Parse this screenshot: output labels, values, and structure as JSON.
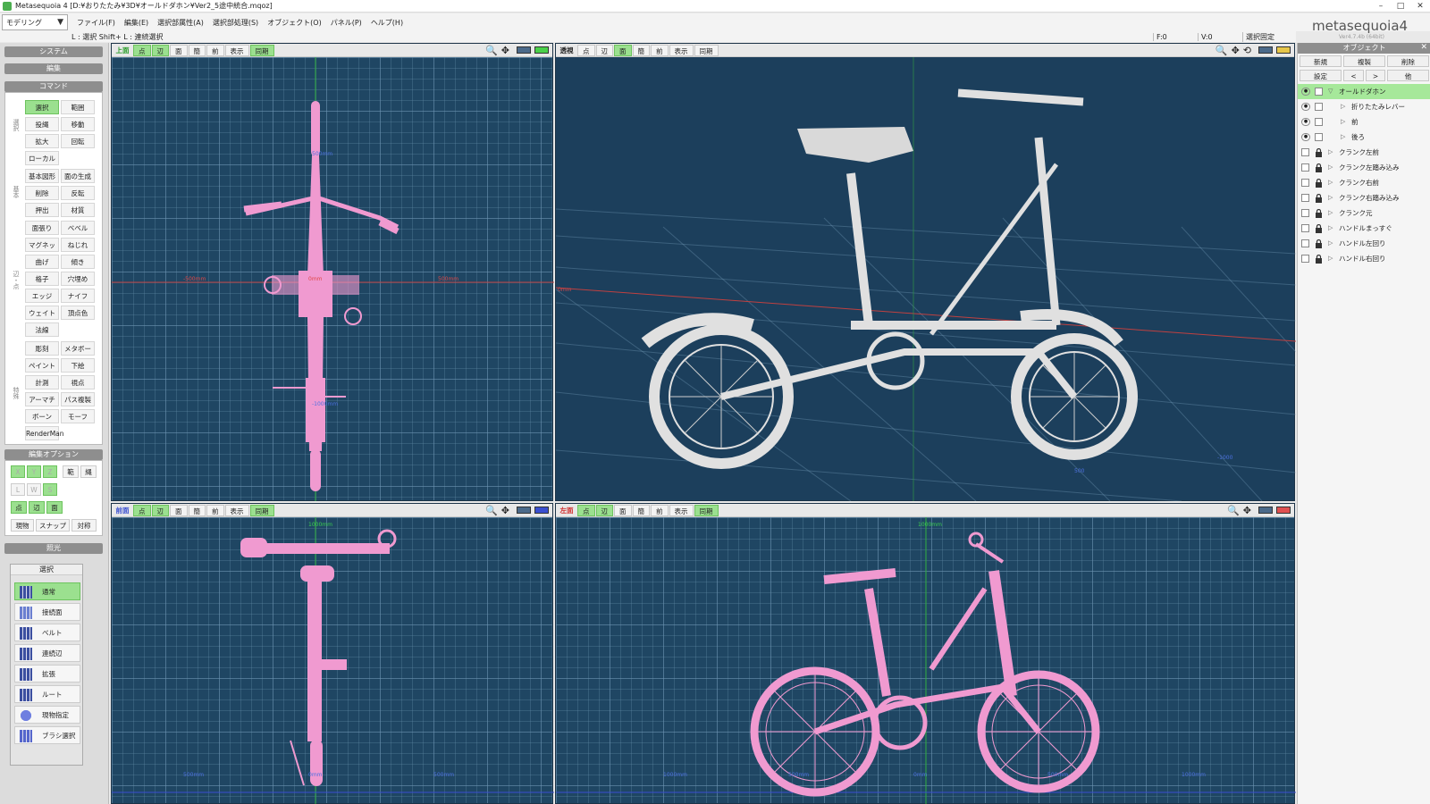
{
  "window": {
    "title": "Metasequoia 4 [D:¥おりたたみ¥3D¥オールドダホン¥Ver2_5途中統合.mqoz]",
    "minimize": "–",
    "maximize": "□",
    "close": "✕"
  },
  "mode": "モデリング",
  "menu": [
    "ファイル(F)",
    "編集(E)",
    "選択部属性(A)",
    "選択部処理(S)",
    "オブジェクト(O)",
    "パネル(P)",
    "ヘルプ(H)"
  ],
  "status": {
    "hint": "L : 選択 Shift+ L : 連続選択",
    "f": "F:0",
    "v": "V:0",
    "lock": "選択固定"
  },
  "logo": {
    "text": "metasequoia4",
    "version": "Ver4.7.4b (64bit)"
  },
  "left": {
    "system": "システム",
    "edit": "編集",
    "command": "コマンド",
    "groups": [
      "選択",
      "基本",
      "辺・点",
      "特殊"
    ],
    "commands": [
      {
        "label": "選択",
        "key": "L",
        "active": true
      },
      {
        "label": "範囲",
        "key": "R"
      },
      {
        "label": "投縄",
        "key": "G"
      },
      {
        "label": "移動",
        "key": "V"
      },
      {
        "label": "拡大",
        "key": "Q"
      },
      {
        "label": "回転",
        "key": "C"
      },
      {
        "label": "ローカル",
        "key": "J"
      },
      {
        "label": "基本図形",
        "key": "Z"
      },
      {
        "label": "面の生成",
        "key": "F"
      },
      {
        "label": "削除",
        "key": "D"
      },
      {
        "label": "反転",
        "key": "I"
      },
      {
        "label": "押出",
        "key": "E"
      },
      {
        "label": "材質",
        "key": "M"
      },
      {
        "label": "面張り",
        "key": "H"
      },
      {
        "label": "ベベル",
        "key": ""
      },
      {
        "label": "マグネット",
        "key": "B"
      },
      {
        "label": "ねじれ",
        "key": ""
      },
      {
        "label": "曲げ",
        "key": ""
      },
      {
        "label": "傾き",
        "key": ""
      },
      {
        "label": "格子",
        "key": ""
      },
      {
        "label": "穴埋め",
        "key": ""
      },
      {
        "label": "エッジ",
        "key": "W"
      },
      {
        "label": "ナイフ",
        "key": "K"
      },
      {
        "label": "ウェイト",
        "key": ""
      },
      {
        "label": "頂点色",
        "key": ""
      },
      {
        "label": "法線",
        "key": ""
      },
      {
        "label": "彫刻",
        "key": ""
      },
      {
        "label": "メタボール",
        "key": ""
      },
      {
        "label": "ペイント",
        "key": ""
      },
      {
        "label": "下絵",
        "key": ""
      },
      {
        "label": "計測",
        "key": ""
      },
      {
        "label": "視点",
        "key": ""
      },
      {
        "label": "アーマチャー",
        "key": ""
      },
      {
        "label": "パス複製",
        "key": ""
      },
      {
        "label": "ボーン",
        "key": ""
      },
      {
        "label": "モーフ",
        "key": ""
      },
      {
        "label": "RenderMan",
        "key": ""
      }
    ],
    "edit_option": "編集オプション",
    "axis": [
      "X",
      "Y",
      "Z"
    ],
    "range": "範",
    "cont": "縄",
    "lwsbtns": [
      "L",
      "W",
      "S"
    ],
    "pem": [
      "点",
      "辺",
      "面"
    ],
    "misc": [
      "現物",
      "スナップ",
      "対称"
    ],
    "lighting": "照光",
    "select_panel": {
      "title": "選択",
      "items": [
        "通常",
        "接続面",
        "ベルト",
        "連続辺",
        "拡張",
        "ルート",
        "現物指定",
        "ブラシ選択"
      ]
    }
  },
  "viewports": {
    "buttons": [
      "点",
      "辺",
      "面",
      "簡",
      "前",
      "表示",
      "同期"
    ],
    "top": {
      "name": "上面"
    },
    "persp": {
      "name": "透視"
    },
    "front": {
      "name": "前面"
    },
    "left": {
      "name": "左面"
    }
  },
  "dims": {
    "top": [
      "500mm",
      "0mm",
      "500mm",
      "-500mm",
      "-1000mm"
    ],
    "front": [
      "1000mm",
      "500mm",
      "0mm",
      "500mm"
    ],
    "left": [
      "1000mm",
      "500mm",
      "0mm",
      "500mm",
      "1000mm",
      "500mm"
    ],
    "persp": [
      "0mm",
      "-500",
      "500",
      "-1000",
      "500",
      "1000"
    ]
  },
  "objects": {
    "title": "オブジェクト",
    "buttons1": [
      "新規",
      "複製",
      "削除"
    ],
    "buttons2": [
      "設定",
      "<",
      ">",
      "他"
    ],
    "items": [
      {
        "name": "オールドダホン",
        "selected": true,
        "level": 0,
        "expanded": true
      },
      {
        "name": "折りたたみレバー",
        "level": 1
      },
      {
        "name": "前",
        "level": 1
      },
      {
        "name": "後ろ",
        "level": 1
      },
      {
        "name": "クランク左前",
        "level": 0,
        "locked": true
      },
      {
        "name": "クランク左踏み込み",
        "level": 0,
        "locked": true
      },
      {
        "name": "クランク右前",
        "level": 0,
        "locked": true
      },
      {
        "name": "クランク右踏み込み",
        "level": 0,
        "locked": true
      },
      {
        "name": "クランク元",
        "level": 0,
        "locked": true
      },
      {
        "name": "ハンドルまっすぐ",
        "level": 0,
        "locked": true
      },
      {
        "name": "ハンドル左回り",
        "level": 0,
        "locked": true
      },
      {
        "name": "ハンドル右回り",
        "level": 0,
        "locked": true
      }
    ]
  },
  "colors": {
    "accent": "#9be08f",
    "viewport_bg": "#1f4663",
    "wire": "#f09ad0",
    "model": "#d9d9d9"
  }
}
